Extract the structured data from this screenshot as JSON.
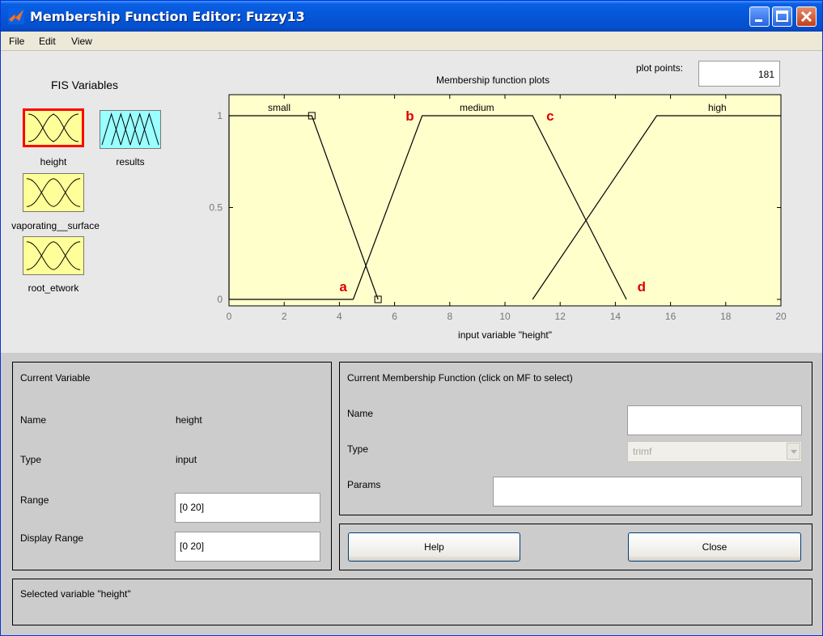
{
  "window": {
    "title": "Membership Function Editor: Fuzzy13"
  },
  "menu": [
    "File",
    "Edit",
    "View"
  ],
  "fis_variables": {
    "title": "FIS Variables",
    "items": [
      {
        "label": "height",
        "kind": "input",
        "selected": true
      },
      {
        "label": "results",
        "kind": "output",
        "selected": false
      },
      {
        "label": "vaporating__surface",
        "kind": "input",
        "selected": false
      },
      {
        "label": "root_etwork",
        "kind": "input",
        "selected": false
      }
    ]
  },
  "plot": {
    "plot_points_label": "plot points:",
    "plot_points_value": "181",
    "title": "Membership function plots",
    "xlabel": "input variable \"height\"",
    "mf_labels": [
      "small",
      "medium",
      "high"
    ],
    "annotations": [
      "a",
      "b",
      "c",
      "d"
    ],
    "colors": {
      "background": "#ffffcc",
      "annotation": "#dd0000"
    }
  },
  "chart_data": {
    "type": "line",
    "title": "Membership function plots",
    "xlabel": "input variable \"height\"",
    "ylabel": "",
    "xlim": [
      0,
      20
    ],
    "ylim": [
      0,
      1
    ],
    "xticks": [
      0,
      2,
      4,
      6,
      8,
      10,
      12,
      14,
      16,
      18,
      20
    ],
    "yticks": [
      0,
      0.5,
      1
    ],
    "series": [
      {
        "name": "small",
        "points": [
          [
            0,
            0
          ],
          [
            0,
            1
          ],
          [
            3,
            1
          ],
          [
            5.4,
            0
          ]
        ]
      },
      {
        "name": "medium",
        "points": [
          [
            4.5,
            0
          ],
          [
            7,
            1
          ],
          [
            11,
            1
          ],
          [
            14.4,
            0
          ]
        ]
      },
      {
        "name": "high",
        "points": [
          [
            11,
            0
          ],
          [
            15.5,
            1
          ],
          [
            20,
            1
          ]
        ]
      },
      {
        "name": "",
        "points": [
          [
            0,
            0
          ],
          [
            4.5,
            0
          ]
        ]
      }
    ],
    "annotations": [
      {
        "text": "a",
        "x": 4,
        "y": 0.07
      },
      {
        "text": "b",
        "x": 6.4,
        "y": 1
      },
      {
        "text": "c",
        "x": 11.5,
        "y": 1
      },
      {
        "text": "d",
        "x": 14.8,
        "y": 0.07
      }
    ],
    "selected_handles": [
      [
        3,
        1
      ],
      [
        5.4,
        0
      ]
    ]
  },
  "current_variable": {
    "title": "Current Variable",
    "name_label": "Name",
    "name_value": "height",
    "type_label": "Type",
    "type_value": "input",
    "range_label": "Range",
    "range_value": "[0 20]",
    "display_range_label": "Display Range",
    "display_range_value": "[0 20]"
  },
  "current_mf": {
    "title": "Current Membership Function (click on MF to select)",
    "name_label": "Name",
    "name_value": "",
    "type_label": "Type",
    "type_value": "trimf",
    "params_label": "Params",
    "params_value": ""
  },
  "buttons": {
    "help": "Help",
    "close": "Close"
  },
  "status": "Selected variable \"height\""
}
